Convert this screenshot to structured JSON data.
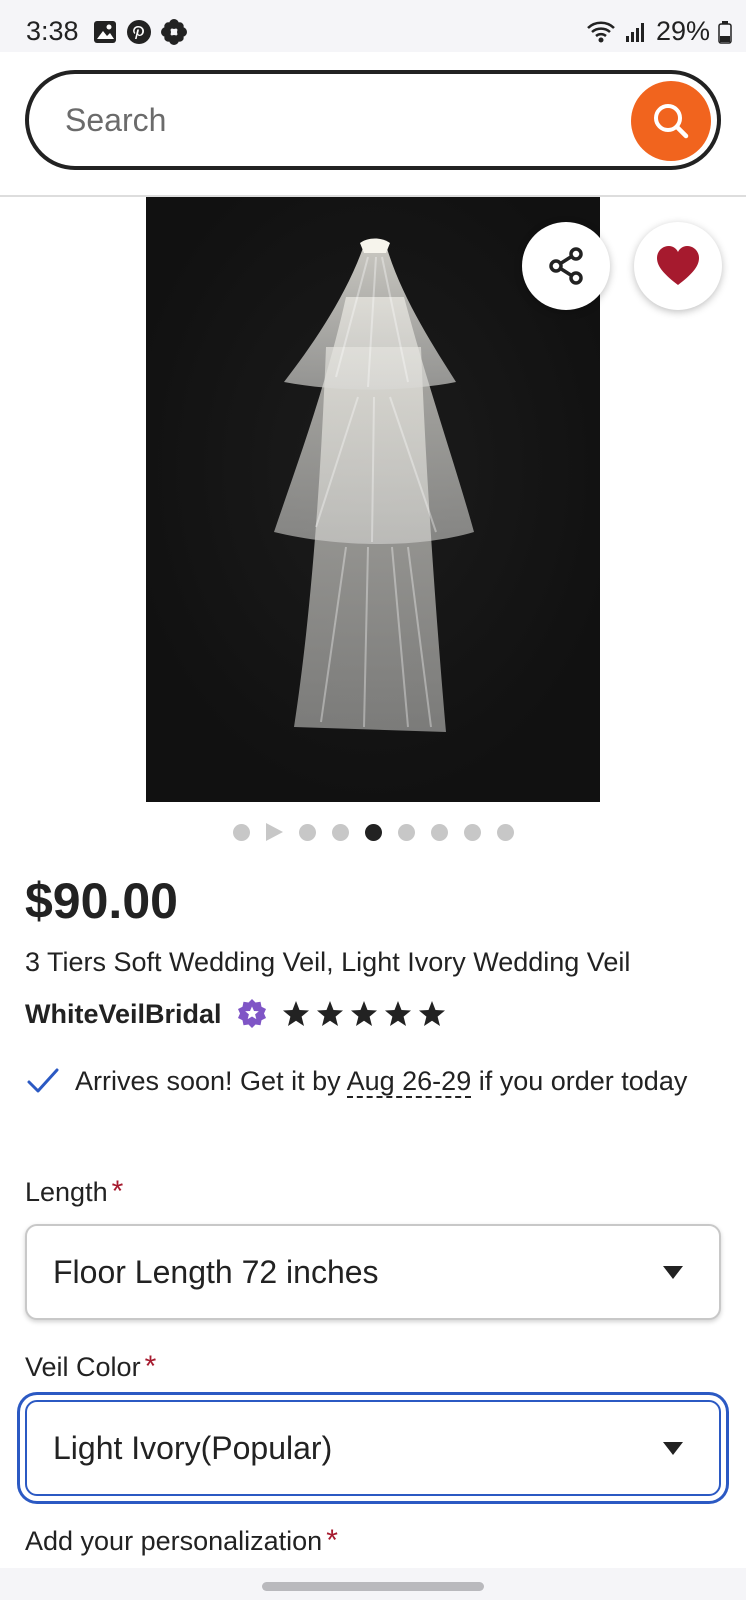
{
  "status_bar": {
    "time": "3:38",
    "battery": "29%",
    "icons": [
      "image-icon",
      "pinterest-icon",
      "flower-icon",
      "wifi-icon",
      "signal-icon",
      "battery-icon"
    ]
  },
  "search": {
    "placeholder": "Search",
    "value": "",
    "button_icon": "search-icon",
    "accent_color": "#f1641e"
  },
  "product": {
    "image_alt": "3 tier white wedding veil on black background",
    "share_icon": "share-icon",
    "favorite_icon": "heart-icon",
    "favorite_color": "#a61a2e",
    "carousel": {
      "count": 9,
      "active_index": 4,
      "video_index": 1
    },
    "price": "$90.00",
    "title": "3 Tiers Soft Wedding Veil, Light Ivory Wedding Veil",
    "shop_name": "WhiteVeilBridal",
    "star_seller_icon": "star-seller-badge-icon",
    "rating": 5,
    "delivery": {
      "prefix": "Arrives soon! Get it by ",
      "date": "Aug 26-29",
      "suffix": " if you order today"
    }
  },
  "options": {
    "length": {
      "label": "Length",
      "required_mark": "*",
      "value": "Floor Length 72 inches"
    },
    "veil_color": {
      "label": "Veil Color",
      "required_mark": "*",
      "value": "Light Ivory(Popular)"
    },
    "personalization": {
      "label": "Add your personalization",
      "required_mark": "*"
    }
  }
}
